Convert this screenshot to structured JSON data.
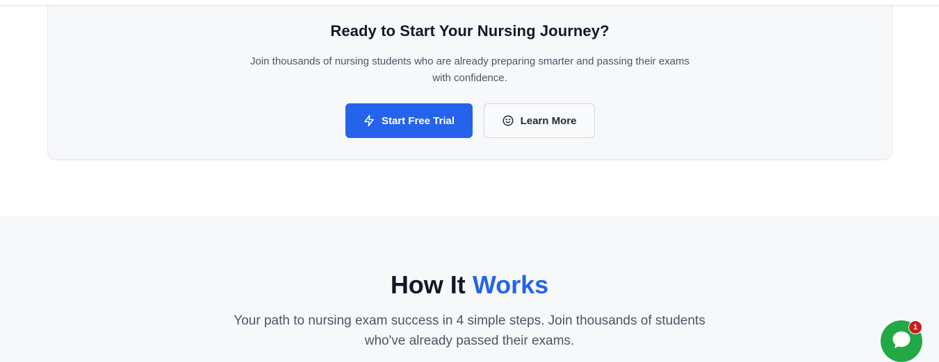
{
  "cta": {
    "title": "Ready to Start Your Nursing Journey?",
    "description": "Join thousands of nursing students who are already preparing smarter and passing their exams with confidence.",
    "primary_button": {
      "label": "Start Free Trial",
      "icon": "lightning-icon"
    },
    "secondary_button": {
      "label": "Learn More",
      "icon": "smiley-icon"
    }
  },
  "how_it_works": {
    "title_part1": "How It",
    "title_accent": "Works",
    "description": "Your path to nursing exam success in 4 simple steps. Join thousands of students who've already passed their exams."
  },
  "chat_widget": {
    "icon": "chat-bubble-icon",
    "badge_count": "1"
  },
  "colors": {
    "accent": "#2563eb",
    "chat_green": "#22a845",
    "badge_red": "#c81e1e"
  }
}
